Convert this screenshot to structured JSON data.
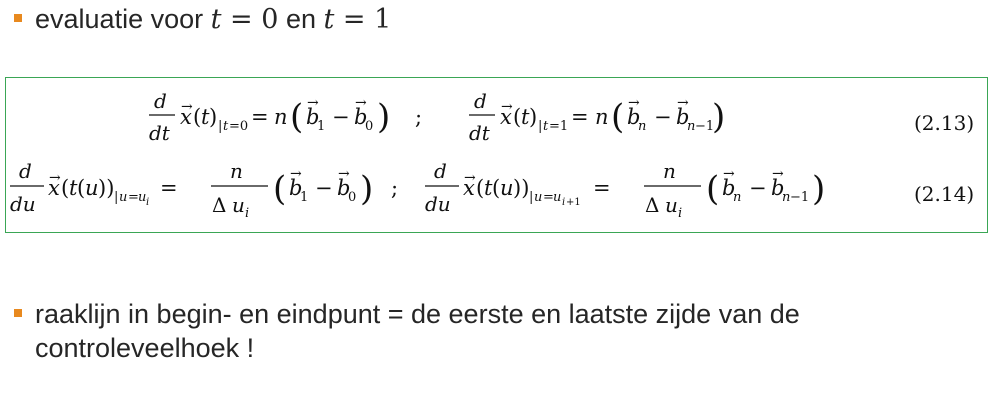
{
  "bullets": [
    {
      "text_before": "evaluatie voor ",
      "var1": "t",
      "eq1": " = 0",
      "mid": " en ",
      "var2": "t",
      "eq2": " = 1"
    },
    {
      "text": "raaklijn in begin- en eindpunt = de eerste en laatste zijde van de controleveelhoek !"
    }
  ],
  "equations": {
    "eq1": {
      "number": "(2.13)",
      "separator": ";"
    },
    "eq2": {
      "number": "(2.14)",
      "separator": ";"
    }
  },
  "colors": {
    "bullet": "#e8891f",
    "box_border": "#3aa655"
  }
}
